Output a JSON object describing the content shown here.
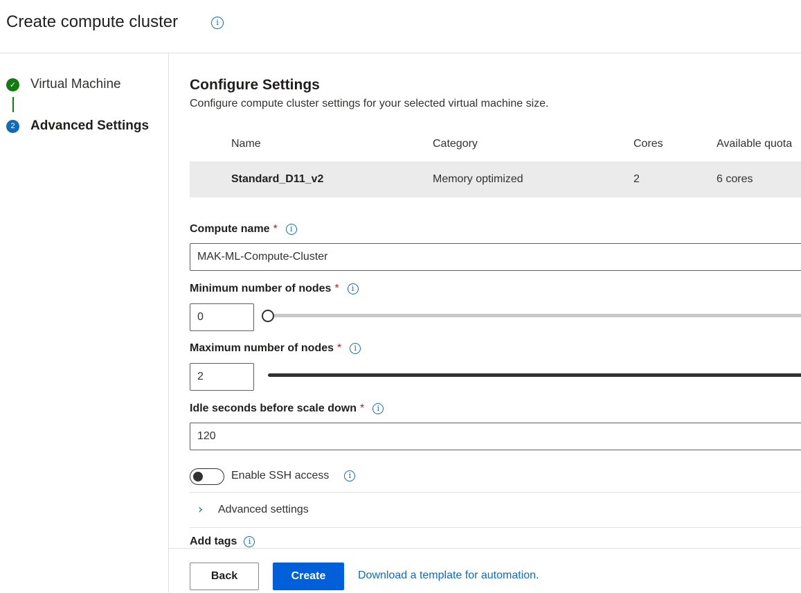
{
  "header": {
    "title": "Create compute cluster",
    "info_icon": "info-icon"
  },
  "wizard": {
    "steps": [
      {
        "label": "Virtual Machine",
        "status": "completed",
        "icon": "check-circle-icon"
      },
      {
        "label": "Advanced Settings",
        "status": "active",
        "number": "2"
      }
    ]
  },
  "main": {
    "section_title": "Configure Settings",
    "section_subtitle": "Configure compute cluster settings for your selected virtual machine size.",
    "vm_table": {
      "columns": [
        "Name",
        "Category",
        "Cores",
        "Available quota"
      ],
      "rows": [
        [
          "Standard_D11_v2",
          "Memory optimized",
          "2",
          "6 cores"
        ]
      ]
    },
    "compute_name": {
      "label": "Compute name",
      "required": "*",
      "value": "MAK-ML-Compute-Cluster"
    },
    "min_nodes": {
      "label": "Minimum number of nodes",
      "required": "*",
      "value": "0"
    },
    "max_nodes": {
      "label": "Maximum number of nodes",
      "required": "*",
      "value": "2"
    },
    "idle_seconds": {
      "label": "Idle seconds before scale down",
      "required": "*",
      "value": "120"
    },
    "ssh_toggle": {
      "label": "Enable SSH access",
      "enabled": false
    },
    "advanced_settings": {
      "label": "Advanced settings",
      "expanded": false
    },
    "add_tags": {
      "label": "Add tags"
    }
  },
  "footer": {
    "back_label": "Back",
    "create_label": "Create",
    "template_link": "Download a template for automation."
  },
  "colors": {
    "accent": "#0f6cbd",
    "primary_button": "#005fd9",
    "success": "#107c10",
    "required": "#a4262c"
  }
}
